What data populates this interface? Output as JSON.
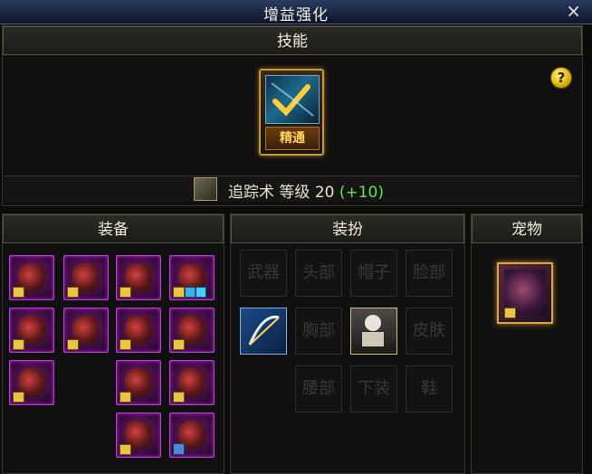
{
  "window": {
    "title": "增益强化",
    "close_label": "×"
  },
  "skill_section": {
    "header": "技能",
    "help_label": "?",
    "mastery_label": "精通",
    "skill_name": "追踪术",
    "level_label": "等级",
    "level_value": "20",
    "level_bonus": "(+10)"
  },
  "equipment_section": {
    "header": "装备"
  },
  "costume_section": {
    "header": "装扮",
    "slots": {
      "weapon": "武器",
      "head": "头部",
      "hat": "帽子",
      "face": "脸部",
      "chest": "胸部",
      "skin": "皮肤",
      "waist": "腰部",
      "bottom": "下装",
      "shoes": "鞋"
    }
  },
  "pet_section": {
    "header": "宠物"
  },
  "colors": {
    "title_bar": "#1c2c48",
    "epic_border": "#c23ae0",
    "level_bonus": "#66e05a",
    "mastery_text": "#ffd45c"
  }
}
